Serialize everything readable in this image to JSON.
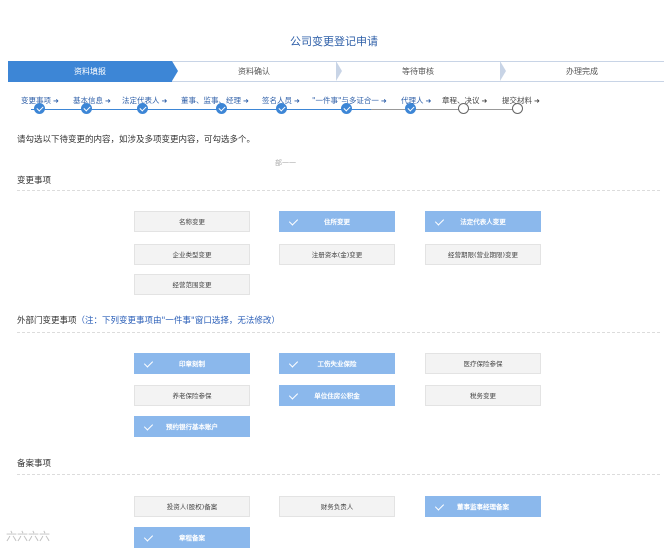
{
  "title": "公司变更登记申请",
  "steps": [
    "资料填报",
    "资料确认",
    "等待审核",
    "办理完成"
  ],
  "substeps": [
    {
      "label": "变更事项",
      "done": true
    },
    {
      "label": "基本信息",
      "done": true
    },
    {
      "label": "法定代表人",
      "done": true
    },
    {
      "label": "董事、监事、经理",
      "done": true
    },
    {
      "label": "签名人员",
      "done": true
    },
    {
      "label": "\"一件事\"与多证合一",
      "done": true
    },
    {
      "label": "代理人",
      "done": true
    },
    {
      "label": "章程、决议",
      "done": false
    },
    {
      "label": "提交材料",
      "done": false
    }
  ],
  "instruction": "请勾选以下待变更的内容，如涉及多项变更内容，可勾选多个。",
  "faded_note": "部一一",
  "sections": {
    "change_items": {
      "label": "变更事项",
      "options": [
        {
          "label": "名称变更",
          "selected": false
        },
        {
          "label": "住所变更",
          "selected": true
        },
        {
          "label": "法定代表人变更",
          "selected": true
        },
        {
          "label": "企业类型变更",
          "selected": false
        },
        {
          "label": "注册资本(金)变更",
          "selected": false
        },
        {
          "label": "经营期限(营业期限)变更",
          "selected": false
        },
        {
          "label": "经营范围变更",
          "selected": false
        }
      ]
    },
    "external_items": {
      "label": "外部门变更事项",
      "note": "（注：下列变更事项由\"一件事\"窗口选择，无法修改）",
      "options": [
        {
          "label": "印章刻制",
          "selected": true
        },
        {
          "label": "工伤失业保险",
          "selected": true
        },
        {
          "label": "医疗保险参保",
          "selected": false
        },
        {
          "label": "养老保险参保",
          "selected": false
        },
        {
          "label": "单位住房公积金",
          "selected": true
        },
        {
          "label": "税务变更",
          "selected": false
        },
        {
          "label": "预约银行基本账户",
          "selected": true
        }
      ]
    },
    "filing_items": {
      "label": "备案事项",
      "options": [
        {
          "label": "投资人(股权)备案",
          "selected": false
        },
        {
          "label": "财务负责人",
          "selected": false
        },
        {
          "label": "董事监事经理备案",
          "selected": true
        },
        {
          "label": "章程备案",
          "selected": true
        }
      ]
    }
  },
  "watermark": "六六六六",
  "colors": {
    "accent": "#3d86d6",
    "selected_option": "#8bb8ec",
    "note": "#2b5fb8"
  }
}
